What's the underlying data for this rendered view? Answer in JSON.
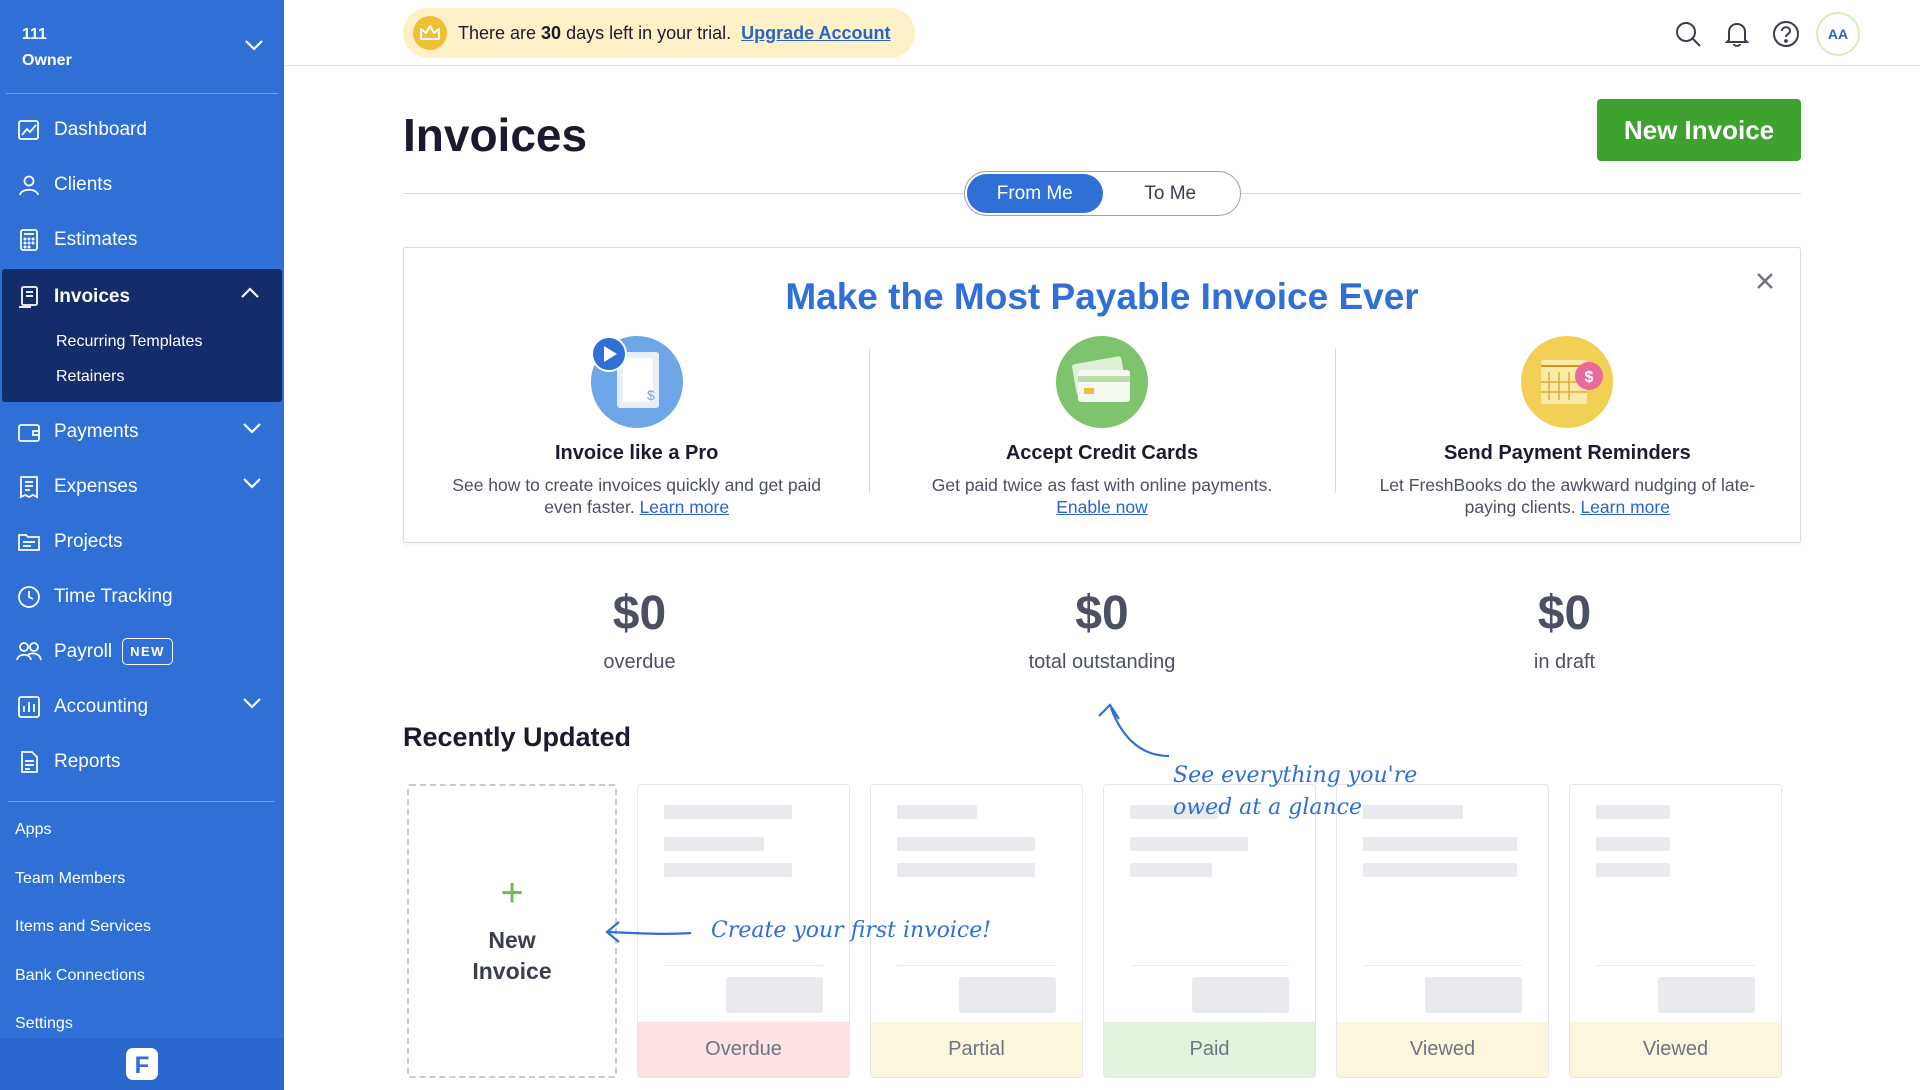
{
  "business": {
    "name": "111",
    "role": "Owner"
  },
  "sidebar": {
    "items": [
      {
        "label": "Dashboard"
      },
      {
        "label": "Clients"
      },
      {
        "label": "Estimates"
      },
      {
        "label": "Invoices",
        "children": [
          "Recurring Templates",
          "Retainers"
        ]
      },
      {
        "label": "Payments"
      },
      {
        "label": "Expenses"
      },
      {
        "label": "Projects"
      },
      {
        "label": "Time Tracking"
      },
      {
        "label": "Payroll",
        "badge": "NEW"
      },
      {
        "label": "Accounting"
      },
      {
        "label": "Reports"
      }
    ],
    "links": [
      "Apps",
      "Team Members",
      "Items and Services",
      "Bank Connections",
      "Settings"
    ],
    "logo": "F"
  },
  "trial": {
    "prefix": "There are",
    "days": "30",
    "suffix": "days left in your trial.",
    "link": "Upgrade Account"
  },
  "topbar": {
    "avatar": "AA",
    "icons": [
      "search-icon",
      "bell-icon",
      "help-icon"
    ]
  },
  "page": {
    "title": "Invoices",
    "new_button": "New Invoice",
    "tabs": [
      "From Me",
      "To Me"
    ],
    "active_tab": "From Me"
  },
  "promo": {
    "title": "Make the Most Payable Invoice Ever",
    "items": [
      {
        "heading": "Invoice like a Pro",
        "text": "See how to create invoices quickly and get paid even faster.",
        "link": "Learn more"
      },
      {
        "heading": "Accept Credit Cards",
        "text": "Get paid twice as fast with online payments.",
        "link": "Enable now"
      },
      {
        "heading": "Send Payment Reminders",
        "text": "Let FreshBooks do the awkward nudging of late-paying clients.",
        "link": "Learn more"
      }
    ]
  },
  "stats": [
    {
      "value": "$0",
      "label": "overdue"
    },
    {
      "value": "$0",
      "label": "total outstanding"
    },
    {
      "value": "$0",
      "label": "in draft"
    }
  ],
  "recent": {
    "title": "Recently Updated",
    "new_card": {
      "plus": "+",
      "label": "New Invoice"
    },
    "cards": [
      {
        "status": "Overdue",
        "color": "#fbe3e4"
      },
      {
        "status": "Partial",
        "color": "#fdf6de"
      },
      {
        "status": "Paid",
        "color": "#e3f2dc"
      },
      {
        "status": "Viewed",
        "color": "#fdf6de"
      },
      {
        "status": "Viewed",
        "color": "#fdf6de"
      }
    ]
  },
  "annotations": {
    "glance": [
      "See everything you're",
      "owed at a glance"
    ],
    "create": "Create your first invoice!"
  },
  "colors": {
    "brand_blue": "#2f6fd6",
    "sidebar_active": "#132c6b",
    "green": "#3ea22f"
  }
}
